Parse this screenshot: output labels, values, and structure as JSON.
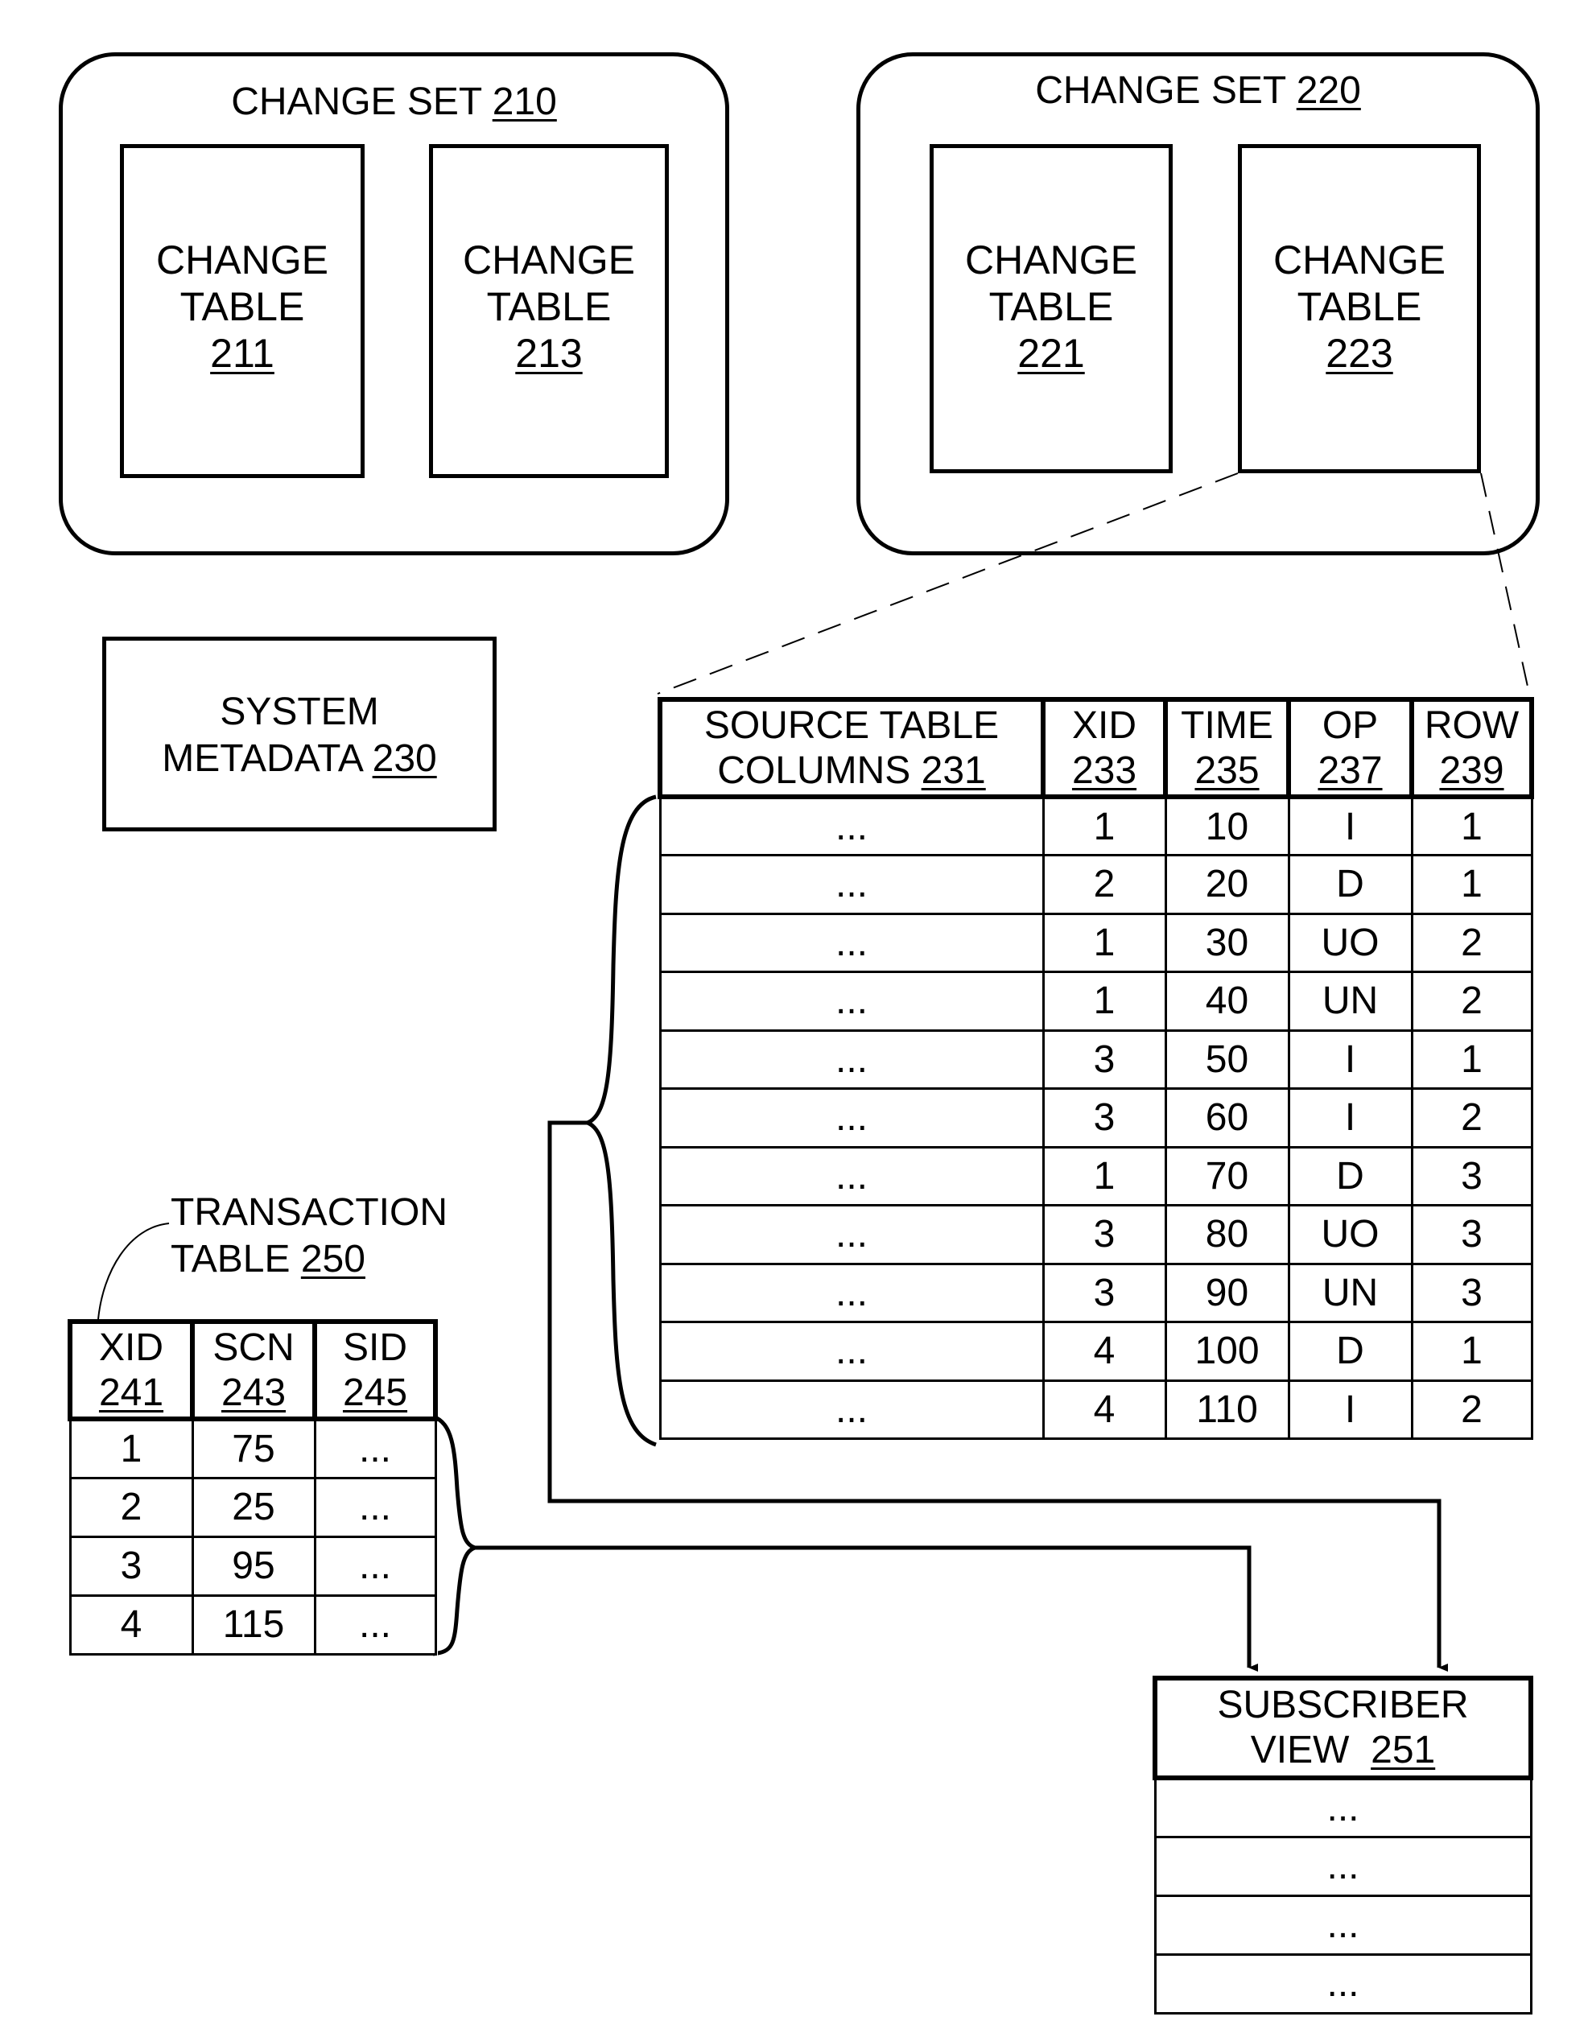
{
  "change_sets": [
    {
      "title": "CHANGE SET",
      "ref": "210",
      "tables": [
        {
          "line1": "CHANGE",
          "line2": "TABLE",
          "ref": "211"
        },
        {
          "line1": "CHANGE",
          "line2": "TABLE",
          "ref": "213"
        }
      ]
    },
    {
      "title": "CHANGE SET",
      "ref": "220",
      "tables": [
        {
          "line1": "CHANGE",
          "line2": "TABLE",
          "ref": "221"
        },
        {
          "line1": "CHANGE",
          "line2": "TABLE",
          "ref": "223"
        }
      ]
    }
  ],
  "system_metadata": {
    "line1": "SYSTEM",
    "line2": "METADATA",
    "ref": "230"
  },
  "change_table_detail": {
    "headers": [
      {
        "line1": "SOURCE TABLE",
        "line2": "COLUMNS",
        "ref": "231"
      },
      {
        "line1": "XID",
        "line2": "",
        "ref": "233"
      },
      {
        "line1": "TIME",
        "line2": "",
        "ref": "235"
      },
      {
        "line1": "OP",
        "line2": "",
        "ref": "237"
      },
      {
        "line1": "ROW",
        "line2": "",
        "ref": "239"
      }
    ],
    "rows": [
      [
        "...",
        "1",
        "10",
        "I",
        "1"
      ],
      [
        "...",
        "2",
        "20",
        "D",
        "1"
      ],
      [
        "...",
        "1",
        "30",
        "UO",
        "2"
      ],
      [
        "...",
        "1",
        "40",
        "UN",
        "2"
      ],
      [
        "...",
        "3",
        "50",
        "I",
        "1"
      ],
      [
        "...",
        "3",
        "60",
        "I",
        "2"
      ],
      [
        "...",
        "1",
        "70",
        "D",
        "3"
      ],
      [
        "...",
        "3",
        "80",
        "UO",
        "3"
      ],
      [
        "...",
        "3",
        "90",
        "UN",
        "3"
      ],
      [
        "...",
        "4",
        "100",
        "D",
        "1"
      ],
      [
        "...",
        "4",
        "110",
        "I",
        "2"
      ]
    ]
  },
  "transaction_table": {
    "title_line1": "TRANSACTION",
    "title_line2": "TABLE",
    "ref": "250",
    "headers": [
      {
        "label": "XID",
        "ref": "241"
      },
      {
        "label": "SCN",
        "ref": "243"
      },
      {
        "label": "SID",
        "ref": "245"
      }
    ],
    "rows": [
      [
        "1",
        "75",
        "..."
      ],
      [
        "2",
        "25",
        "..."
      ],
      [
        "3",
        "95",
        "..."
      ],
      [
        "4",
        "115",
        "..."
      ]
    ]
  },
  "subscriber_view": {
    "line1": "SUBSCRIBER",
    "line2": "VIEW",
    "ref": "251",
    "rows": [
      "...",
      "...",
      "...",
      "..."
    ]
  }
}
